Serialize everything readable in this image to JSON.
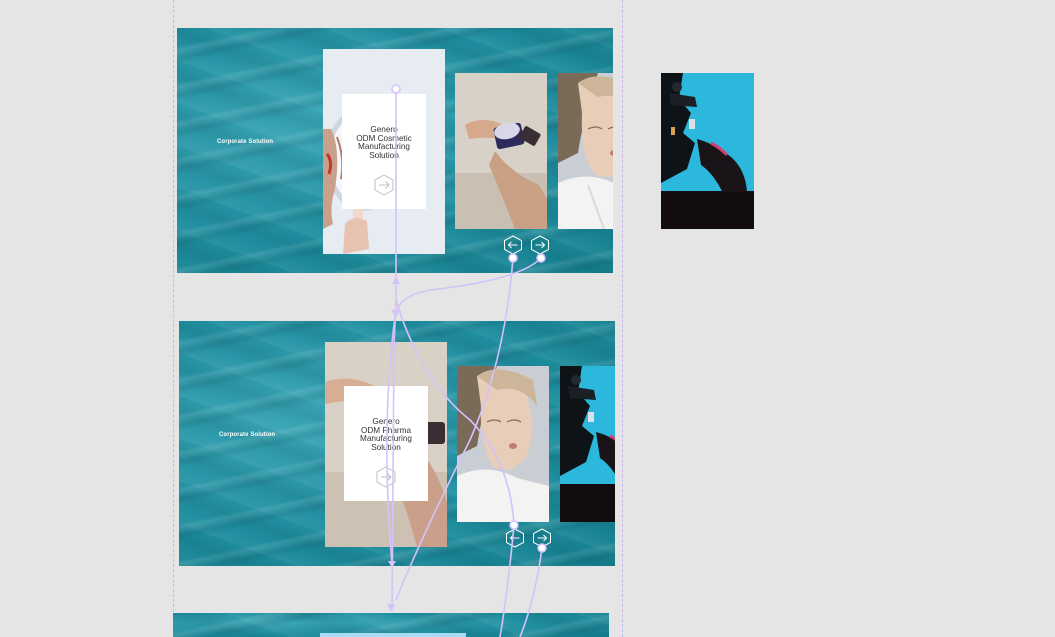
{
  "canvas": {
    "background": "#e5e5e6",
    "guide_color": "#c9b8f0",
    "flow_color": "#d4c2fb"
  },
  "frames": [
    {
      "label": "Corporate Solution",
      "card_lines": [
        "Genero",
        "ODM Cosmetic",
        "Manufacturing",
        "Solution"
      ],
      "prev_icon": "arrow-left-icon",
      "next_icon": "arrow-right-icon",
      "card_icon": "arrow-right-icon"
    },
    {
      "label": "Corporate Solution",
      "card_lines": [
        "Genero",
        "ODM Pharma",
        "Manufacturing",
        "Solution"
      ],
      "prev_icon": "arrow-left-icon",
      "next_icon": "arrow-right-icon",
      "card_icon": "arrow-right-icon"
    }
  ],
  "colors": {
    "teal": "#1f8e9f",
    "button_stroke": "#ffffff",
    "card_bg": "#ffffff",
    "frame3_panel": "#a8dcf3"
  },
  "images": [
    "woman-mirror-photo",
    "hand-cream-jar-photo",
    "woman-portrait-photo",
    "laboratory-microscope-photo",
    "hand-cream-jar-photo",
    "woman-portrait-photo",
    "laboratory-microscope-photo"
  ]
}
